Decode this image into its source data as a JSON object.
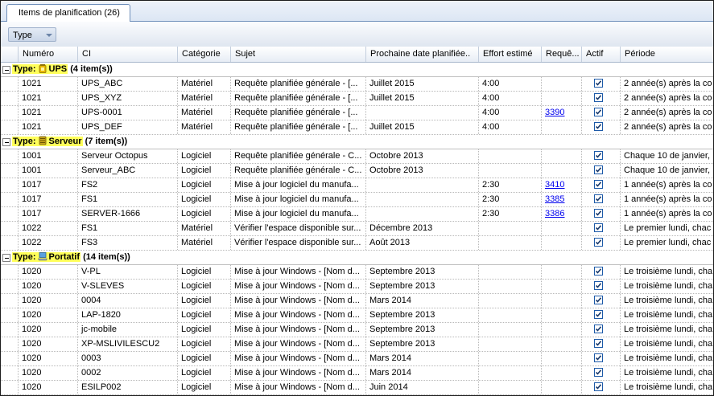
{
  "tab": {
    "label": "Items de planification (26)"
  },
  "toolbar": {
    "group_button_label": "Type"
  },
  "columns": [
    "Numéro",
    "CI",
    "Catégorie",
    "Sujet",
    "Prochaine date planifiée..",
    "Effort estimé",
    "Requê...",
    "Actif",
    "Période"
  ],
  "groups": [
    {
      "label_prefix": "Type:",
      "name": "UPS",
      "count": "(4 item(s))",
      "icon": "battery-icon",
      "rows": [
        {
          "numero": "1021",
          "ci": "UPS_ABC",
          "categorie": "Matériel",
          "sujet": "Requête planifiée générale - [...",
          "date": "Juillet 2015",
          "effort": "4:00",
          "requete": "",
          "actif": true,
          "periode": "2 année(s) après la co"
        },
        {
          "numero": "1021",
          "ci": "UPS_XYZ",
          "categorie": "Matériel",
          "sujet": "Requête planifiée générale - [...",
          "date": "Juillet 2015",
          "effort": "4:00",
          "requete": "",
          "actif": true,
          "periode": "2 année(s) après la co"
        },
        {
          "numero": "1021",
          "ci": "UPS-0001",
          "categorie": "Matériel",
          "sujet": "Requête planifiée générale - [...",
          "date": "",
          "effort": "4:00",
          "requete": "3390",
          "actif": true,
          "periode": "2 année(s) après la co"
        },
        {
          "numero": "1021",
          "ci": "UPS_DEF",
          "categorie": "Matériel",
          "sujet": "Requête planifiée générale - [...",
          "date": "Juillet 2015",
          "effort": "4:00",
          "requete": "",
          "actif": true,
          "periode": "2 année(s) après la co"
        }
      ]
    },
    {
      "label_prefix": "Type:",
      "name": "Serveur",
      "count": "(7 item(s))",
      "icon": "server-icon",
      "rows": [
        {
          "numero": "1001",
          "ci": "Serveur Octopus",
          "categorie": "Logiciel",
          "sujet": "Requête planifiée générale - C...",
          "date": "Octobre 2013",
          "effort": "",
          "requete": "",
          "actif": true,
          "periode": "Chaque 10 de janvier,"
        },
        {
          "numero": "1001",
          "ci": "Serveur_ABC",
          "categorie": "Logiciel",
          "sujet": "Requête planifiée générale - C...",
          "date": "Octobre 2013",
          "effort": "",
          "requete": "",
          "actif": true,
          "periode": "Chaque 10 de janvier,"
        },
        {
          "numero": "1017",
          "ci": "FS2",
          "categorie": "Logiciel",
          "sujet": "Mise à jour logiciel du manufa...",
          "date": "",
          "effort": "2:30",
          "requete": "3410",
          "actif": true,
          "periode": "1 année(s) après la co"
        },
        {
          "numero": "1017",
          "ci": "FS1",
          "categorie": "Logiciel",
          "sujet": "Mise à jour logiciel du manufa...",
          "date": "",
          "effort": "2:30",
          "requete": "3385",
          "actif": true,
          "periode": "1 année(s) après la co"
        },
        {
          "numero": "1017",
          "ci": "SERVER-1666",
          "categorie": "Logiciel",
          "sujet": "Mise à jour logiciel du manufa...",
          "date": "",
          "effort": "2:30",
          "requete": "3386",
          "actif": true,
          "periode": "1 année(s) après la co"
        },
        {
          "numero": "1022",
          "ci": "FS1",
          "categorie": "Matériel",
          "sujet": "Vérifier l'espace disponible sur...",
          "date": "Décembre 2013",
          "effort": "",
          "requete": "",
          "actif": true,
          "periode": "Le premier lundi, chac"
        },
        {
          "numero": "1022",
          "ci": "FS3",
          "categorie": "Matériel",
          "sujet": "Vérifier l'espace disponible sur...",
          "date": "Août 2013",
          "effort": "",
          "requete": "",
          "actif": true,
          "periode": "Le premier lundi, chac"
        }
      ]
    },
    {
      "label_prefix": "Type:",
      "name": "Portatif",
      "count": "(14 item(s))",
      "icon": "laptop-icon",
      "rows": [
        {
          "numero": "1020",
          "ci": "V-PL",
          "categorie": "Logiciel",
          "sujet": "Mise à jour Windows - [Nom d...",
          "date": "Septembre 2013",
          "effort": "",
          "requete": "",
          "actif": true,
          "periode": "Le troisième lundi, cha"
        },
        {
          "numero": "1020",
          "ci": "V-SLEVES",
          "categorie": "Logiciel",
          "sujet": "Mise à jour Windows - [Nom d...",
          "date": "Septembre 2013",
          "effort": "",
          "requete": "",
          "actif": true,
          "periode": "Le troisième lundi, cha"
        },
        {
          "numero": "1020",
          "ci": "0004",
          "categorie": "Logiciel",
          "sujet": "Mise à jour Windows - [Nom d...",
          "date": "Mars 2014",
          "effort": "",
          "requete": "",
          "actif": true,
          "periode": "Le troisième lundi, cha"
        },
        {
          "numero": "1020",
          "ci": "LAP-1820",
          "categorie": "Logiciel",
          "sujet": "Mise à jour Windows - [Nom d...",
          "date": "Septembre 2013",
          "effort": "",
          "requete": "",
          "actif": true,
          "periode": "Le troisième lundi, cha"
        },
        {
          "numero": "1020",
          "ci": "jc-mobile",
          "categorie": "Logiciel",
          "sujet": "Mise à jour Windows - [Nom d...",
          "date": "Septembre 2013",
          "effort": "",
          "requete": "",
          "actif": true,
          "periode": "Le troisième lundi, cha"
        },
        {
          "numero": "1020",
          "ci": "XP-MSLIVILESCU2",
          "categorie": "Logiciel",
          "sujet": "Mise à jour Windows - [Nom d...",
          "date": "Septembre 2013",
          "effort": "",
          "requete": "",
          "actif": true,
          "periode": "Le troisième lundi, cha"
        },
        {
          "numero": "1020",
          "ci": "0003",
          "categorie": "Logiciel",
          "sujet": "Mise à jour Windows - [Nom d...",
          "date": "Mars 2014",
          "effort": "",
          "requete": "",
          "actif": true,
          "periode": "Le troisième lundi, cha"
        },
        {
          "numero": "1020",
          "ci": "0002",
          "categorie": "Logiciel",
          "sujet": "Mise à jour Windows - [Nom d...",
          "date": "Mars 2014",
          "effort": "",
          "requete": "",
          "actif": true,
          "periode": "Le troisième lundi, cha"
        },
        {
          "numero": "1020",
          "ci": "ESILP002",
          "categorie": "Logiciel",
          "sujet": "Mise à jour Windows - [Nom d...",
          "date": "Juin 2014",
          "effort": "",
          "requete": "",
          "actif": true,
          "periode": "Le troisième lundi, cha"
        }
      ]
    }
  ]
}
